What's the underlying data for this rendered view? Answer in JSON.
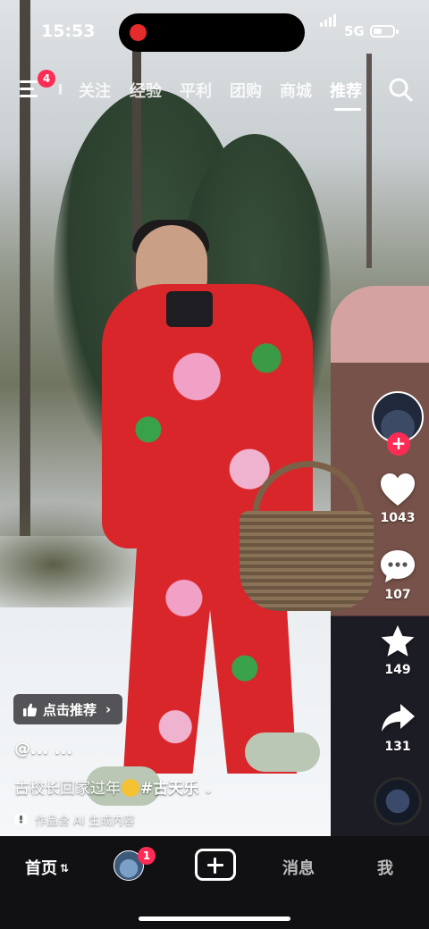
{
  "status_bar": {
    "time": "15:53",
    "network": "5G",
    "battery_level": 0.45
  },
  "top_nav": {
    "menu_badge": "4",
    "tabs": [
      {
        "label": "关注",
        "active": false
      },
      {
        "label": "经验",
        "active": false
      },
      {
        "label": "平利",
        "active": false
      },
      {
        "label": "团购",
        "active": false
      },
      {
        "label": "商城",
        "active": false
      },
      {
        "label": "推荐",
        "active": true
      }
    ],
    "icons": {
      "menu": "menu-icon",
      "search": "search-icon"
    }
  },
  "actions": {
    "follow_icon": "plus-icon",
    "like": {
      "icon": "heart-icon",
      "count": "1043"
    },
    "comment": {
      "icon": "comment-icon",
      "count": "107"
    },
    "favorite": {
      "icon": "star-icon",
      "count": "149"
    },
    "share": {
      "icon": "share-icon",
      "count": "131"
    }
  },
  "video": {
    "recommend_pill": {
      "label": "点击推荐",
      "chevron": "›"
    },
    "author": "@... ...",
    "caption": {
      "text": "古校长回家过年",
      "emoji": "grinning-sweat-emoji",
      "hashtag": "#古天乐",
      "more": "⌄"
    },
    "ai_note": "作品含 AI 生成内容"
  },
  "bottom_nav": {
    "home": "首页",
    "friend_badge": "1",
    "messages": "消息",
    "me": "我"
  },
  "colors": {
    "accent": "#fe2c55",
    "bar_bg": "#111113"
  }
}
